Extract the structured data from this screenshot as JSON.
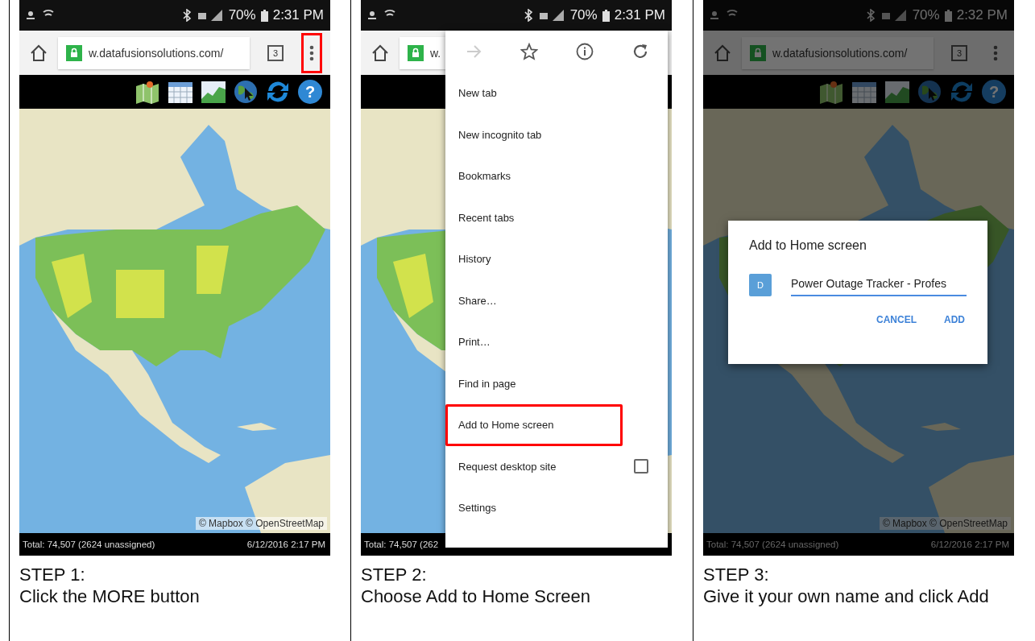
{
  "steps": [
    {
      "status_bar": {
        "battery": "70%",
        "time": "2:31 PM"
      },
      "browser": {
        "url": "w.datafusionsolutions.com/",
        "tab_count": "3",
        "more_highlighted": true
      },
      "toolbar": {
        "help": "?"
      },
      "map": {
        "attribution": "© Mapbox © OpenStreetMap"
      },
      "footer": {
        "total": "Total: 74,507 (2624 unassigned)",
        "date": "6/12/2016 2:17 PM"
      },
      "dimmed": false,
      "caption": [
        "STEP 1:",
        "Click the MORE button"
      ]
    },
    {
      "status_bar": {
        "battery": "70%",
        "time": "2:31 PM"
      },
      "browser": {
        "url": "w."
      },
      "footer": {
        "total": "Total: 74,507 (262"
      },
      "dimmed": false,
      "menu": {
        "items": [
          {
            "kind": "item",
            "label": "New tab",
            "highlighted": false
          },
          {
            "kind": "item",
            "label": "New incognito tab",
            "highlighted": false
          },
          {
            "kind": "item",
            "label": "Bookmarks",
            "highlighted": false
          },
          {
            "kind": "item",
            "label": "Recent tabs",
            "highlighted": false
          },
          {
            "kind": "item",
            "label": "History",
            "highlighted": false
          },
          {
            "kind": "item",
            "label": "Share…",
            "highlighted": false
          },
          {
            "kind": "item",
            "label": "Print…",
            "highlighted": false
          },
          {
            "kind": "item",
            "label": "Find in page",
            "highlighted": false
          },
          {
            "kind": "item",
            "label": "Add to Home screen",
            "highlighted": true
          },
          {
            "kind": "checkbox",
            "label": "Request desktop site",
            "checked": false,
            "highlighted": false
          },
          {
            "kind": "item",
            "label": "Settings",
            "highlighted": false
          }
        ]
      },
      "caption": [
        "STEP 2:",
        "Choose Add to Home Screen"
      ]
    },
    {
      "status_bar": {
        "battery": "70%",
        "time": "2:32 PM"
      },
      "browser": {
        "url": "w.datafusionsolutions.com/",
        "tab_count": "3",
        "more_highlighted": false
      },
      "toolbar": {
        "help": "?"
      },
      "map": {
        "attribution": "© Mapbox © OpenStreetMap"
      },
      "footer": {
        "total": "Total: 74,507 (2624 unassigned)",
        "date": "6/12/2016 2:17 PM"
      },
      "dimmed": true,
      "dialog": {
        "title": "Add to Home screen",
        "icon_letter": "D",
        "value": "Power Outage Tracker - Profes",
        "buttons": [
          "CANCEL",
          "ADD"
        ]
      },
      "caption": [
        "STEP 3:",
        "Give it your own name and click Add"
      ]
    }
  ]
}
